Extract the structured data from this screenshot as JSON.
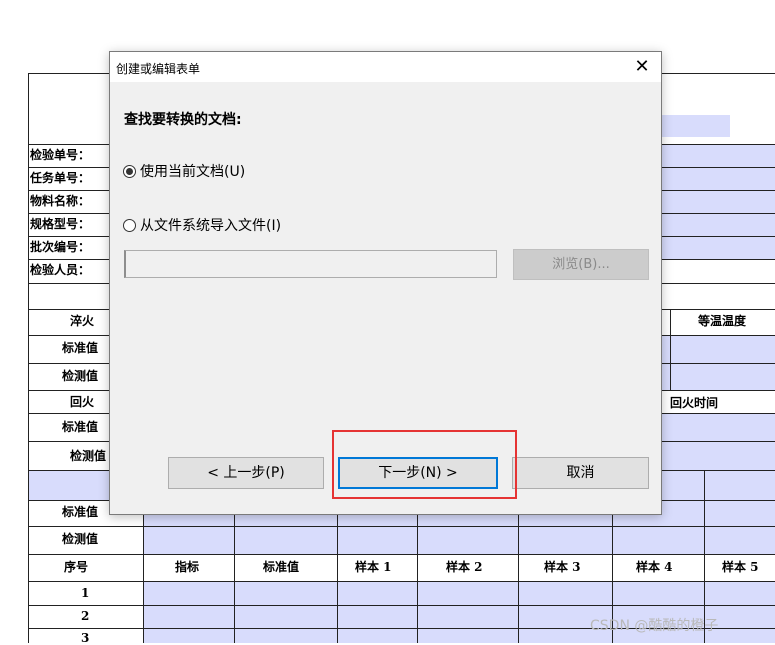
{
  "document": {
    "field_labels": [
      "检验单号：",
      "任务单号：",
      "物料名称：",
      "规格型号：",
      "批次编号：",
      "检验人员："
    ],
    "quench_label": "淬火",
    "temp_header": "等温温度",
    "standard_label": "标准值",
    "measured_label": "检测值",
    "temper_label": "回火",
    "temper_time_header": "回火时间",
    "columns": {
      "seq": "序号",
      "metric": "指标",
      "standard": "标准值",
      "sample1": "样本 1",
      "sample2": "样本 2",
      "sample3": "样本 3",
      "sample4": "样本 4",
      "sample5": "样本 5"
    },
    "row_numbers": [
      "1",
      "2",
      "3"
    ]
  },
  "dialog": {
    "title": "创建或编辑表单",
    "close_icon": "close-icon",
    "heading": "查找要转换的文档:",
    "option_current": "使用当前文档(U)",
    "option_current_selected": true,
    "option_import": "从文件系统导入文件(I)",
    "path_value": "",
    "browse_label": "浏览(B)...",
    "back_label": "< 上一步(P)",
    "next_label": "下一步(N) >",
    "cancel_label": "取消",
    "highlight_color": "#e53333",
    "focus_color": "#0078d7"
  },
  "watermark": "CSDN @酷酷的橙子"
}
